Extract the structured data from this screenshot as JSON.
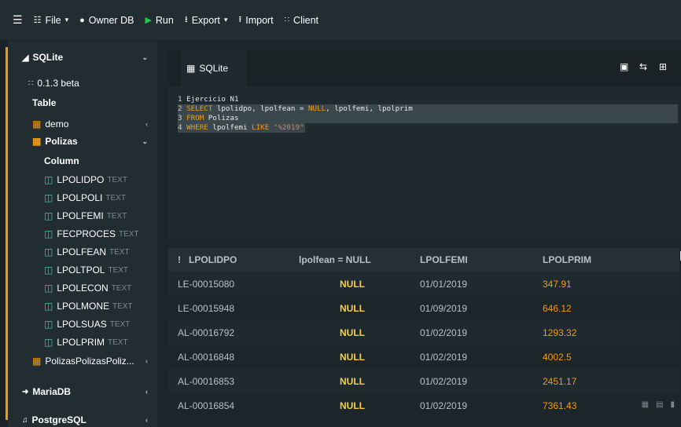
{
  "toolbar": {
    "file": "File",
    "owner_db": "Owner DB",
    "run": "Run",
    "export": "Export",
    "import": "Import",
    "client": "Client"
  },
  "sidebar": {
    "sqlite": "SQLite",
    "version": "0.1.3 beta",
    "table_heading": "Table",
    "tables": [
      {
        "name": "demo"
      },
      {
        "name": "Polizas"
      },
      {
        "name": "PolizasPolizasPoliz..."
      }
    ],
    "column_heading": "Column",
    "columns": [
      {
        "name": "LPOLIDPO",
        "type": "TEXT"
      },
      {
        "name": "LPOLPOLI",
        "type": "TEXT"
      },
      {
        "name": "LPOLFEMI",
        "type": "TEXT"
      },
      {
        "name": "FECPROCES",
        "type": "TEXT"
      },
      {
        "name": "LPOLFEAN",
        "type": "TEXT"
      },
      {
        "name": "LPOLTPOL",
        "type": "TEXT"
      },
      {
        "name": "LPOLECON",
        "type": "TEXT"
      },
      {
        "name": "LPOLMONE",
        "type": "TEXT"
      },
      {
        "name": "LPOLSUAS",
        "type": "TEXT"
      },
      {
        "name": "LPOLPRIM",
        "type": "TEXT"
      }
    ],
    "mariadb": "MariaDB",
    "postgresql": "PostgreSQL"
  },
  "editor": {
    "tab": "SQLite",
    "lines": [
      {
        "n": "1",
        "t1": "Ejercicio N1"
      },
      {
        "n": "2",
        "k1": "SELECT",
        "t1": " lpolidpo, lpolfean = ",
        "k2": "NULL",
        "t2": ", lpolfemi, lpolprim"
      },
      {
        "n": "3",
        "k1": "FROM",
        "t1": " Polizas"
      },
      {
        "n": "4",
        "k1": "WHERE",
        "t1": " lpolfemi ",
        "k2": "LIKE",
        "s1": "\"%2019\""
      }
    ]
  },
  "results": {
    "sort_icon": "!",
    "columns": [
      "LPOLIDPO",
      "lpolfean = NULL",
      "LPOLFEMI",
      "LPOLPRIM"
    ],
    "rows": [
      {
        "idpo": "LE-00015080",
        "fean": "NULL",
        "femi": "01/01/2019",
        "prim": "347.91"
      },
      {
        "idpo": "LE-00015948",
        "fean": "NULL",
        "femi": "01/09/2019",
        "prim": "646.12"
      },
      {
        "idpo": "AL-00016792",
        "fean": "NULL",
        "femi": "01/02/2019",
        "prim": "1293.32"
      },
      {
        "idpo": "AL-00016848",
        "fean": "NULL",
        "femi": "01/02/2019",
        "prim": "4002.5"
      },
      {
        "idpo": "AL-00016853",
        "fean": "NULL",
        "femi": "01/02/2019",
        "prim": "2451.17"
      },
      {
        "idpo": "AL-00016854",
        "fean": "NULL",
        "femi": "01/02/2019",
        "prim": "7361.43"
      }
    ]
  }
}
